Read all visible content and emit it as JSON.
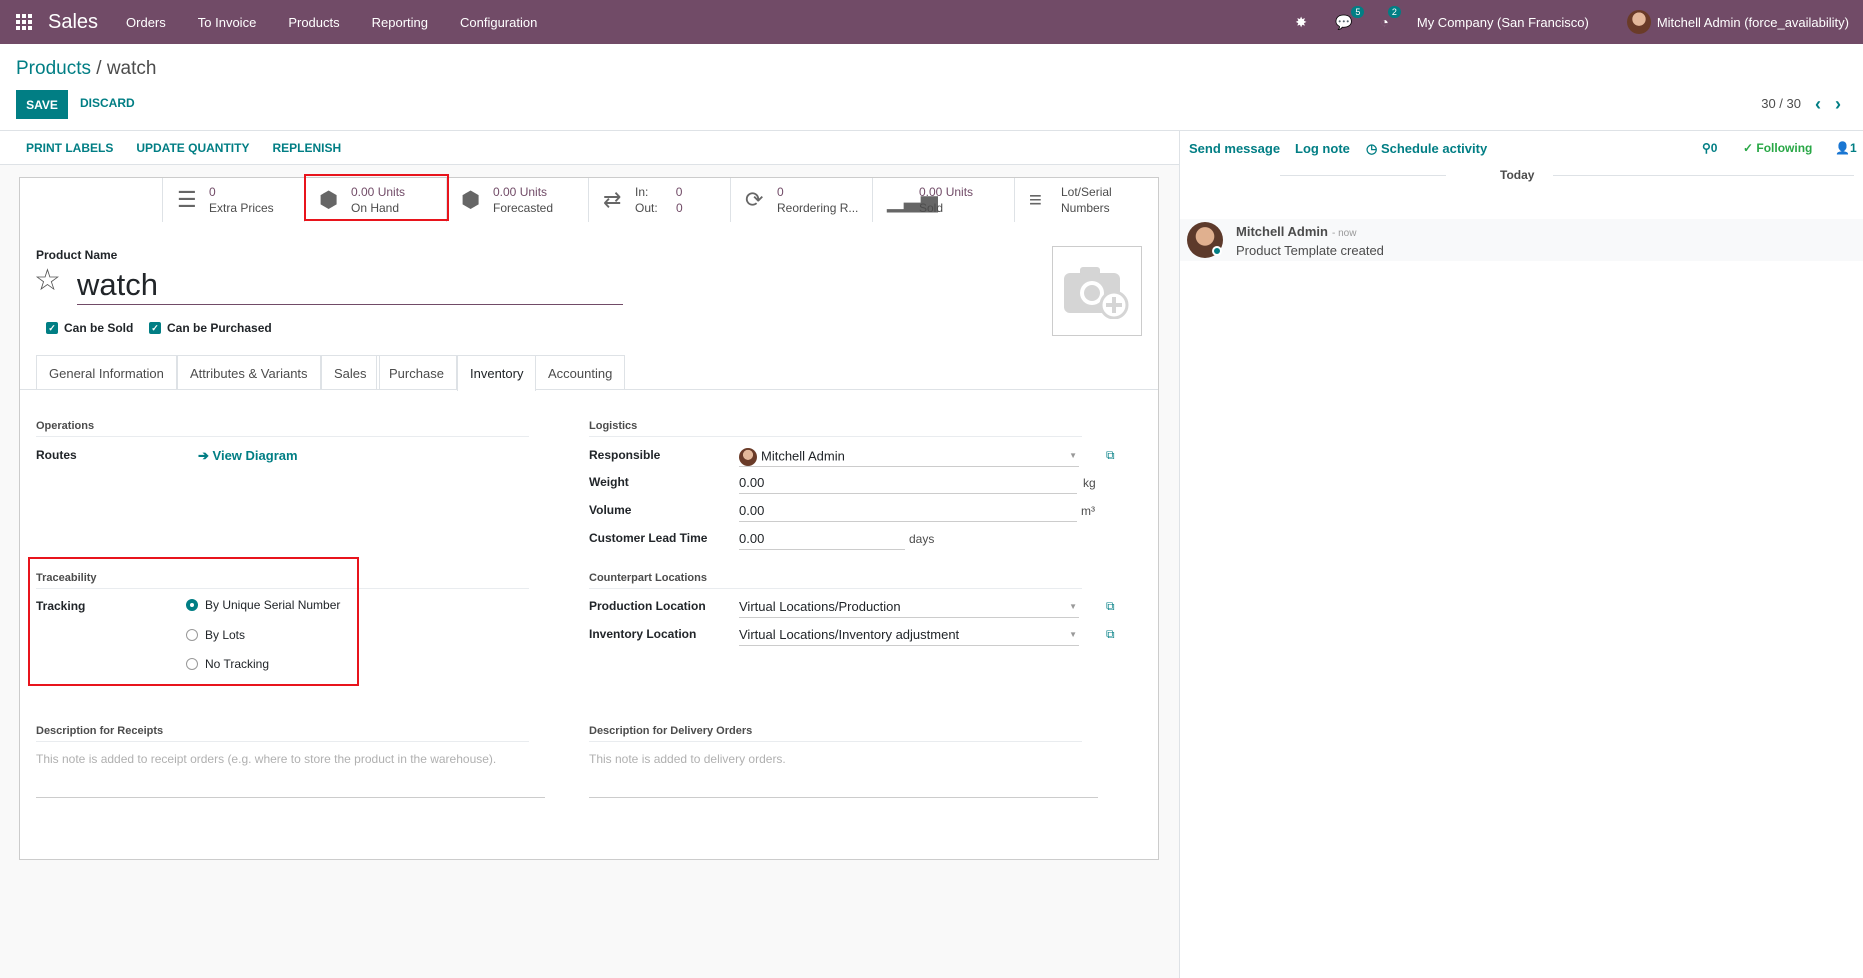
{
  "navbar": {
    "app_name": "Sales",
    "menu": [
      "Orders",
      "To Invoice",
      "Products",
      "Reporting",
      "Configuration"
    ],
    "messages_badge": "5",
    "activities_badge": "2",
    "company": "My Company (San Francisco)",
    "user": "Mitchell Admin (force_availability)"
  },
  "control": {
    "breadcrumb_parent": "Products",
    "breadcrumb_sep": " / ",
    "breadcrumb_current": "watch",
    "save_label": "SAVE",
    "discard_label": "DISCARD",
    "pager": "30 / 30"
  },
  "statusbar": {
    "print_labels": "PRINT LABELS",
    "update_quantity": "UPDATE QUANTITY",
    "replenish": "REPLENISH"
  },
  "stats": [
    {
      "value": "0",
      "label": "Extra Prices",
      "icon": "list-icon"
    },
    {
      "value": "0.00 Units",
      "label": "On Hand",
      "icon": "cubes-icon"
    },
    {
      "value": "0.00 Units",
      "label": "Forecasted",
      "icon": "cubes-icon"
    },
    {
      "in_label": "In:",
      "in_value": "0",
      "out_label": "Out:",
      "out_value": "0",
      "icon": "exchange-icon"
    },
    {
      "value": "0",
      "label": "Reordering R...",
      "icon": "refresh-icon"
    },
    {
      "value": "0.00 Units",
      "label": "Sold",
      "icon": "signal-icon"
    },
    {
      "label1": "Lot/Serial",
      "label2": "Numbers",
      "icon": "bars-icon"
    }
  ],
  "product": {
    "name_label": "Product Name",
    "name": "watch",
    "can_be_sold": "Can be Sold",
    "can_be_purchased": "Can be Purchased"
  },
  "tabs": [
    "General Information",
    "Attributes & Variants",
    "Sales",
    "Purchase",
    "Inventory",
    "Accounting"
  ],
  "active_tab": "Inventory",
  "inventory": {
    "operations_title": "Operations",
    "routes_label": "Routes",
    "view_diagram": "View Diagram",
    "logistics_title": "Logistics",
    "responsible_label": "Responsible",
    "responsible_value": "Mitchell Admin",
    "weight_label": "Weight",
    "weight_value": "0.00",
    "weight_unit": "kg",
    "volume_label": "Volume",
    "volume_value": "0.00",
    "volume_unit": "m³",
    "lead_time_label": "Customer Lead Time",
    "lead_time_value": "0.00",
    "lead_time_unit": "days",
    "traceability_title": "Traceability",
    "tracking_label": "Tracking",
    "tracking_options": [
      "By Unique Serial Number",
      "By Lots",
      "No Tracking"
    ],
    "tracking_selected": "By Unique Serial Number",
    "counterpart_title": "Counterpart Locations",
    "production_label": "Production Location",
    "production_value": "Virtual Locations/Production",
    "inventory_loc_label": "Inventory Location",
    "inventory_loc_value": "Virtual Locations/Inventory adjustment",
    "receipts_title": "Description for Receipts",
    "receipts_placeholder": "This note is added to receipt orders (e.g. where to store the product in the warehouse).",
    "delivery_title": "Description for Delivery Orders",
    "delivery_placeholder": "This note is added to delivery orders."
  },
  "chatter": {
    "send_message": "Send message",
    "log_note": "Log note",
    "schedule_activity": "Schedule activity",
    "attachments": "0",
    "following": "Following",
    "followers": "1",
    "today": "Today",
    "message_author": "Mitchell Admin",
    "message_time": "- now",
    "message_body": "Product Template created"
  },
  "colors": {
    "brand": "#714b67",
    "accent": "#017e84",
    "highlight": "#e8141c",
    "following": "#28a745"
  }
}
